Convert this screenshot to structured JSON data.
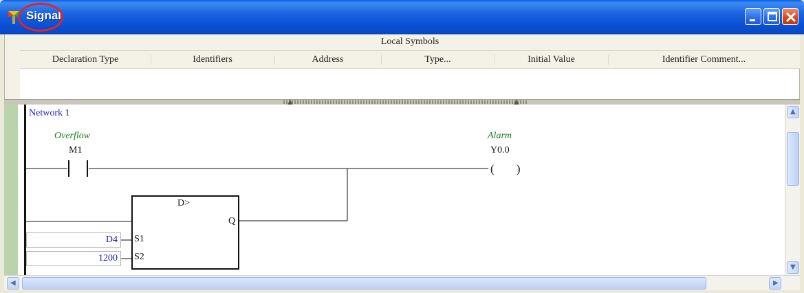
{
  "window": {
    "title": "Signal",
    "icon": "app-icon",
    "buttons": [
      "minimize-icon",
      "maximize-icon",
      "close-icon"
    ]
  },
  "symbols": {
    "header": "Local Symbols",
    "columns": [
      "Declaration Type",
      "Identifiers",
      "Address",
      "Type...",
      "Initial Value",
      "Identifier Comment..."
    ]
  },
  "ladder": {
    "network_label": "Network 1",
    "contact": {
      "comment": "Overflow",
      "device": "M1"
    },
    "coil": {
      "comment": "Alarm",
      "device": "Y0.0",
      "symbol": "( )"
    },
    "function_block": {
      "name": "D>",
      "output": "Q",
      "inputs": [
        {
          "pin": "S1",
          "value": "D4"
        },
        {
          "pin": "S2",
          "value": "1200"
        }
      ]
    }
  },
  "colors": {
    "titlebar": "#0b52d6",
    "network_label": "#2020d0",
    "comment": "#1e7a1e",
    "rail": "#b9d3aa",
    "highlight_circle": "#e0262b"
  }
}
